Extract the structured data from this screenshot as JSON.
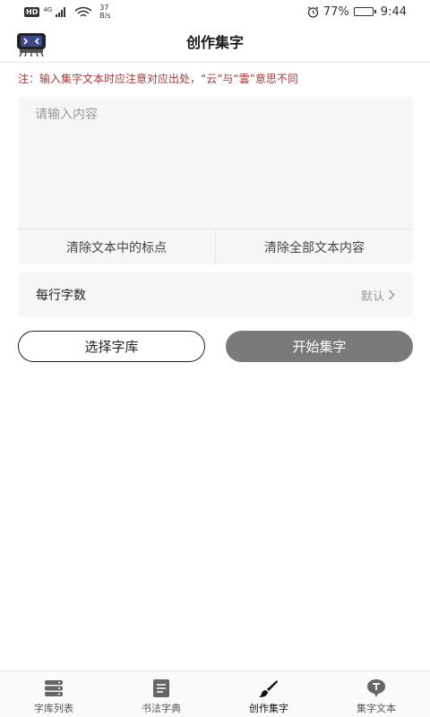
{
  "status_bar": {
    "hd_label": "HD",
    "network_gen": "4G",
    "speed_value": "37",
    "speed_unit": "B/s",
    "battery_percent": "77%",
    "battery_level": 0.77,
    "time": "9:44"
  },
  "header": {
    "title": "创作集字"
  },
  "note_text": "注：输入集字文本时应注意对应出处，“云”与“雲”意思不同",
  "content_input": {
    "placeholder": "请输入内容",
    "value": ""
  },
  "card_actions": {
    "clear_punctuation_label": "清除文本中的标点",
    "clear_all_label": "清除全部文本内容"
  },
  "chars_per_row": {
    "label": "每行字数",
    "value": "默认"
  },
  "buttons": {
    "select_font_label": "选择字库",
    "start_label": "开始集字"
  },
  "tabs": [
    {
      "label": "字库列表",
      "icon": "font-library-icon",
      "active": false
    },
    {
      "label": "书法字典",
      "icon": "dictionary-icon",
      "active": false
    },
    {
      "label": "创作集字",
      "icon": "brush-icon",
      "active": true
    },
    {
      "label": "集字文本",
      "icon": "text-bubble-icon",
      "active": false
    }
  ],
  "colors": {
    "note": "#a33a3a",
    "start_button": "#7a7a7a",
    "card_bg": "#f6f6f6"
  }
}
